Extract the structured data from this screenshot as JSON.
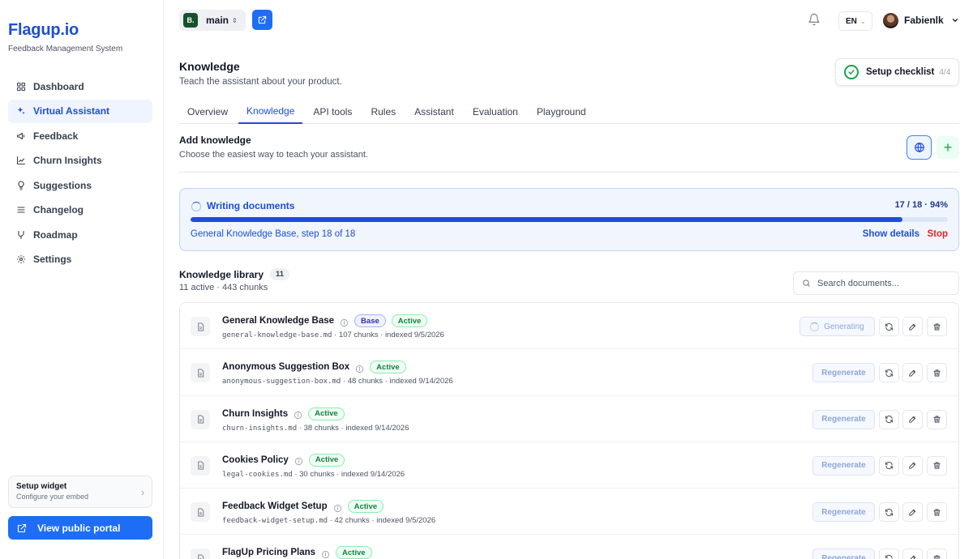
{
  "brand": {
    "name": "Flagup.io",
    "tagline": "Feedback Management System"
  },
  "sidebar": {
    "items": [
      {
        "label": "Dashboard",
        "icon": "grid-icon",
        "active": false
      },
      {
        "label": "Virtual Assistant",
        "icon": "sparkles-icon",
        "active": true
      },
      {
        "label": "Feedback",
        "icon": "megaphone-icon",
        "active": false
      },
      {
        "label": "Churn Insights",
        "icon": "chart-icon",
        "active": false
      },
      {
        "label": "Suggestions",
        "icon": "lightbulb-icon",
        "active": false
      },
      {
        "label": "Changelog",
        "icon": "list-icon",
        "active": false
      },
      {
        "label": "Roadmap",
        "icon": "branch-icon",
        "active": false
      },
      {
        "label": "Settings",
        "icon": "gear-icon",
        "active": false
      }
    ],
    "setup_widget": {
      "title": "Setup widget",
      "subtitle": "Configure your embed"
    },
    "portal_button": "View public portal"
  },
  "topbar": {
    "branch_initial": "B.",
    "branch_name": "main",
    "language": "EN",
    "user_name": "Fabienlk"
  },
  "header": {
    "title": "Knowledge",
    "subtitle": "Teach the assistant about your product.",
    "checklist_label": "Setup checklist",
    "checklist_count": "4/4"
  },
  "tabs": [
    {
      "label": "Overview",
      "active": false
    },
    {
      "label": "Knowledge",
      "active": true
    },
    {
      "label": "API tools",
      "active": false
    },
    {
      "label": "Rules",
      "active": false
    },
    {
      "label": "Assistant",
      "active": false
    },
    {
      "label": "Evaluation",
      "active": false
    },
    {
      "label": "Playground",
      "active": false
    }
  ],
  "add_knowledge": {
    "title": "Add knowledge",
    "subtitle": "Choose the easiest way to teach your assistant."
  },
  "progress": {
    "title": "Writing documents",
    "count": "17 / 18 · 94%",
    "percent": 94,
    "step": "General Knowledge Base, step 18 of 18",
    "show_details": "Show details",
    "stop": "Stop"
  },
  "library": {
    "title": "Knowledge library",
    "count": "11",
    "summary": "11 active · 443 chunks",
    "search_placeholder": "Search documents...",
    "documents": [
      {
        "name": "General Knowledge Base",
        "base_badge": "Base",
        "status": "Active",
        "file": "general-knowledge-base.md",
        "details": " · 107 chunks · indexed 9/5/2026",
        "action": "Generating",
        "generating": true
      },
      {
        "name": "Anonymous Suggestion Box",
        "base_badge": "",
        "status": "Active",
        "file": "anonymous-suggestion-box.md",
        "details": " · 48 chunks · indexed 9/14/2026",
        "action": "Regenerate",
        "generating": false
      },
      {
        "name": "Churn Insights",
        "base_badge": "",
        "status": "Active",
        "file": "churn-insights.md",
        "details": " · 38 chunks · indexed 9/14/2026",
        "action": "Regenerate",
        "generating": false
      },
      {
        "name": "Cookies Policy",
        "base_badge": "",
        "status": "Active",
        "file": "legal-cookies.md",
        "details": " · 30 chunks · indexed 9/14/2026",
        "action": "Regenerate",
        "generating": false
      },
      {
        "name": "Feedback Widget Setup",
        "base_badge": "",
        "status": "Active",
        "file": "feedback-widget-setup.md",
        "details": " · 42 chunks · indexed 9/5/2026",
        "action": "Regenerate",
        "generating": false
      },
      {
        "name": "FlagUp Pricing Plans",
        "base_badge": "",
        "status": "Active",
        "file": "",
        "details": "",
        "action": "Regenerate",
        "generating": false
      }
    ]
  },
  "colors": {
    "accent": "#1d4ed8",
    "primary_button": "#1d6ef5",
    "success": "#16a34a",
    "danger": "#dc2626"
  }
}
